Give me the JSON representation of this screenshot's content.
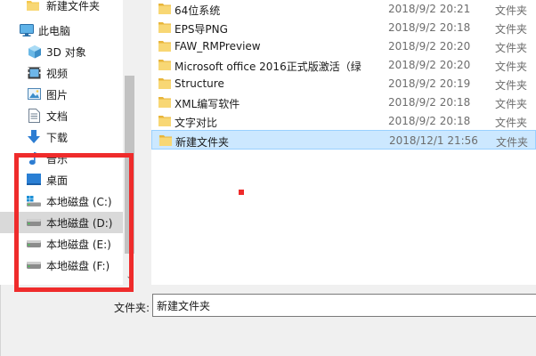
{
  "nav": {
    "items": [
      {
        "label": "新建文件夹",
        "icon": "folder-icon"
      },
      {
        "label": "此电脑",
        "icon": "computer-icon"
      },
      {
        "label": "3D 对象",
        "icon": "3d-objects-icon"
      },
      {
        "label": "视频",
        "icon": "video-icon"
      },
      {
        "label": "图片",
        "icon": "pictures-icon"
      },
      {
        "label": "文档",
        "icon": "documents-icon"
      },
      {
        "label": "下载",
        "icon": "download-icon"
      },
      {
        "label": "音乐",
        "icon": "music-icon"
      },
      {
        "label": "桌面",
        "icon": "desktop-icon"
      },
      {
        "label": "本地磁盘 (C:)",
        "icon": "windows-drive-icon"
      },
      {
        "label": "本地磁盘 (D:)",
        "icon": "drive-icon",
        "selected": true
      },
      {
        "label": "本地磁盘 (E:)",
        "icon": "drive-icon"
      },
      {
        "label": "本地磁盘 (F:)",
        "icon": "drive-icon"
      }
    ]
  },
  "files": [
    {
      "name": "64位系统",
      "date": "2018/9/2 20:21",
      "type": "文件夹"
    },
    {
      "name": "EPS导PNG",
      "date": "2018/9/2 20:18",
      "type": "文件夹"
    },
    {
      "name": "FAW_RMPreview",
      "date": "2018/9/2 20:20",
      "type": "文件夹"
    },
    {
      "name": "Microsoft office 2016正式版激活（绿",
      "date": "2018/9/2 20:20",
      "type": "文件夹"
    },
    {
      "name": "Structure",
      "date": "2018/9/2 20:19",
      "type": "文件夹"
    },
    {
      "name": "XML编写软件",
      "date": "2018/9/2 20:18",
      "type": "文件夹"
    },
    {
      "name": "文字对比",
      "date": "2018/9/2 20:18",
      "type": "文件夹"
    },
    {
      "name": "新建文件夹",
      "date": "2018/12/1 21:56",
      "type": "文件夹",
      "selected": true
    }
  ],
  "bottom": {
    "folder_label": "文件夹:",
    "folder_value": "新建文件夹"
  },
  "colors": {
    "highlight": "#ef2b2b",
    "selection": "#cce8ff",
    "folder": "#f5c84c"
  }
}
